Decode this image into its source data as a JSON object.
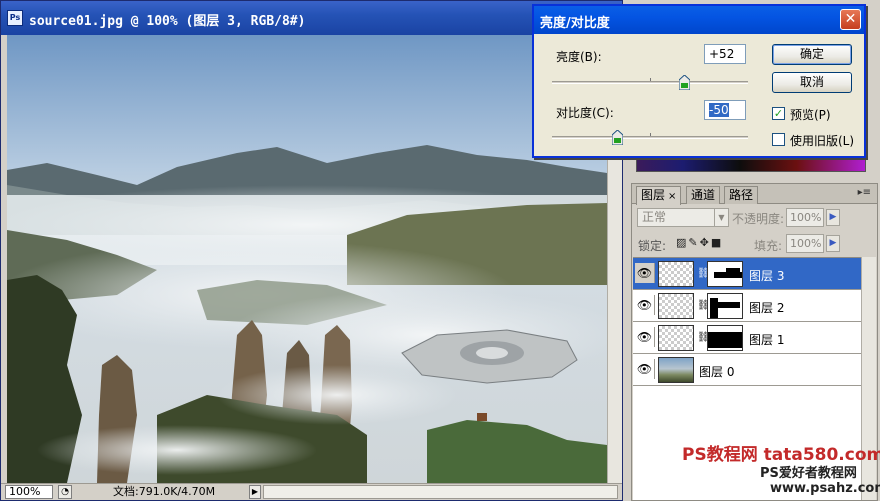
{
  "document": {
    "title": "source01.jpg @ 100% (图层 3, RGB/8#)",
    "ps_icon": "Ps",
    "zoom": "100%",
    "doc_info": "文档:791.0K/4.70M"
  },
  "dialog": {
    "title": "亮度/对比度",
    "brightness_label": "亮度(B):",
    "brightness_value": "+52",
    "brightness_level": 52,
    "contrast_label": "对比度(C):",
    "contrast_value": "-50",
    "contrast_level": -50,
    "ok_label": "确定",
    "cancel_label": "取消",
    "preview_label": "预览(P)",
    "preview_checked": true,
    "legacy_label": "使用旧版(L)",
    "legacy_checked": false
  },
  "layers_panel": {
    "tabs": [
      {
        "label": "图层",
        "active": true
      },
      {
        "label": "通道",
        "active": false
      },
      {
        "label": "路径",
        "active": false
      }
    ],
    "blend_mode": "正常",
    "opacity_label": "不透明度:",
    "opacity_value": "100%",
    "lock_label": "锁定:",
    "fill_label": "填充:",
    "fill_value": "100%",
    "layers": [
      {
        "name": "图层 3",
        "selected": true,
        "has_mask": true
      },
      {
        "name": "图层 2",
        "selected": false,
        "has_mask": true
      },
      {
        "name": "图层 1",
        "selected": false,
        "has_mask": true
      },
      {
        "name": "图层 0",
        "selected": false,
        "has_mask": false
      }
    ]
  },
  "watermarks": {
    "line1": "PS教程网 tata580.com",
    "line2": "PS爱好者教程网",
    "line3": "www.psahz.com"
  },
  "colors": {
    "title_bar": "#2553b6",
    "dialog_title": "#0454e2",
    "selected_layer": "#3168c6",
    "watermark_red": "#c32a2a"
  }
}
